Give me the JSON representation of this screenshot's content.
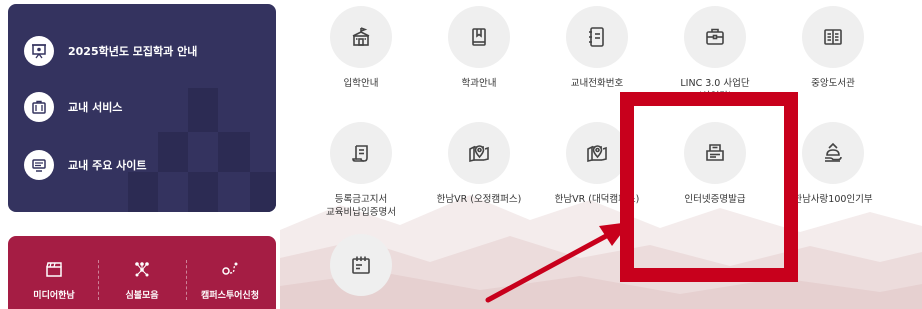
{
  "side_menu": {
    "items": [
      {
        "label": "2025학년도 모집학과 안내",
        "icon": "presentation-board-icon"
      },
      {
        "label": "교내 서비스",
        "icon": "briefcase-icon"
      },
      {
        "label": "교내 주요 사이트",
        "icon": "monitor-icon"
      }
    ]
  },
  "media_menu": {
    "items": [
      {
        "label": "미디어한남",
        "icon": "clapperboard-icon"
      },
      {
        "label": "심볼모음",
        "icon": "symbol-network-icon"
      },
      {
        "label": "캠퍼스투어신청",
        "icon": "route-pin-icon"
      }
    ]
  },
  "quick_menu": {
    "items": [
      {
        "label": "입학안내",
        "icon": "school-building-icon"
      },
      {
        "label": "학과안내",
        "icon": "book-bookmark-icon"
      },
      {
        "label": "교내전화번호",
        "icon": "address-book-icon"
      },
      {
        "label": "LINC 3.0 사업단\n(상업단)",
        "icon": "briefcase-icon"
      },
      {
        "label": "중앙도서관",
        "icon": "open-book-icon"
      },
      {
        "label": "등록금고지서\n교육비납입증명서",
        "icon": "document-scroll-icon"
      },
      {
        "label": "한남VR (오정캠퍼스)",
        "icon": "map-pin-icon"
      },
      {
        "label": "한남VR (대덕캠퍼스)",
        "icon": "map-pin-icon"
      },
      {
        "label": "인터넷증명발급",
        "icon": "printer-certificate-icon"
      },
      {
        "label": "한남사랑100인기부",
        "icon": "donation-hand-icon"
      },
      {
        "label": "",
        "icon": "calendar-icon"
      }
    ]
  },
  "colors": {
    "navy_panel": "#34335f",
    "crimson_panel": "#a51d44",
    "icon_circle": "#efefef",
    "annotation_red": "#c8001c"
  }
}
